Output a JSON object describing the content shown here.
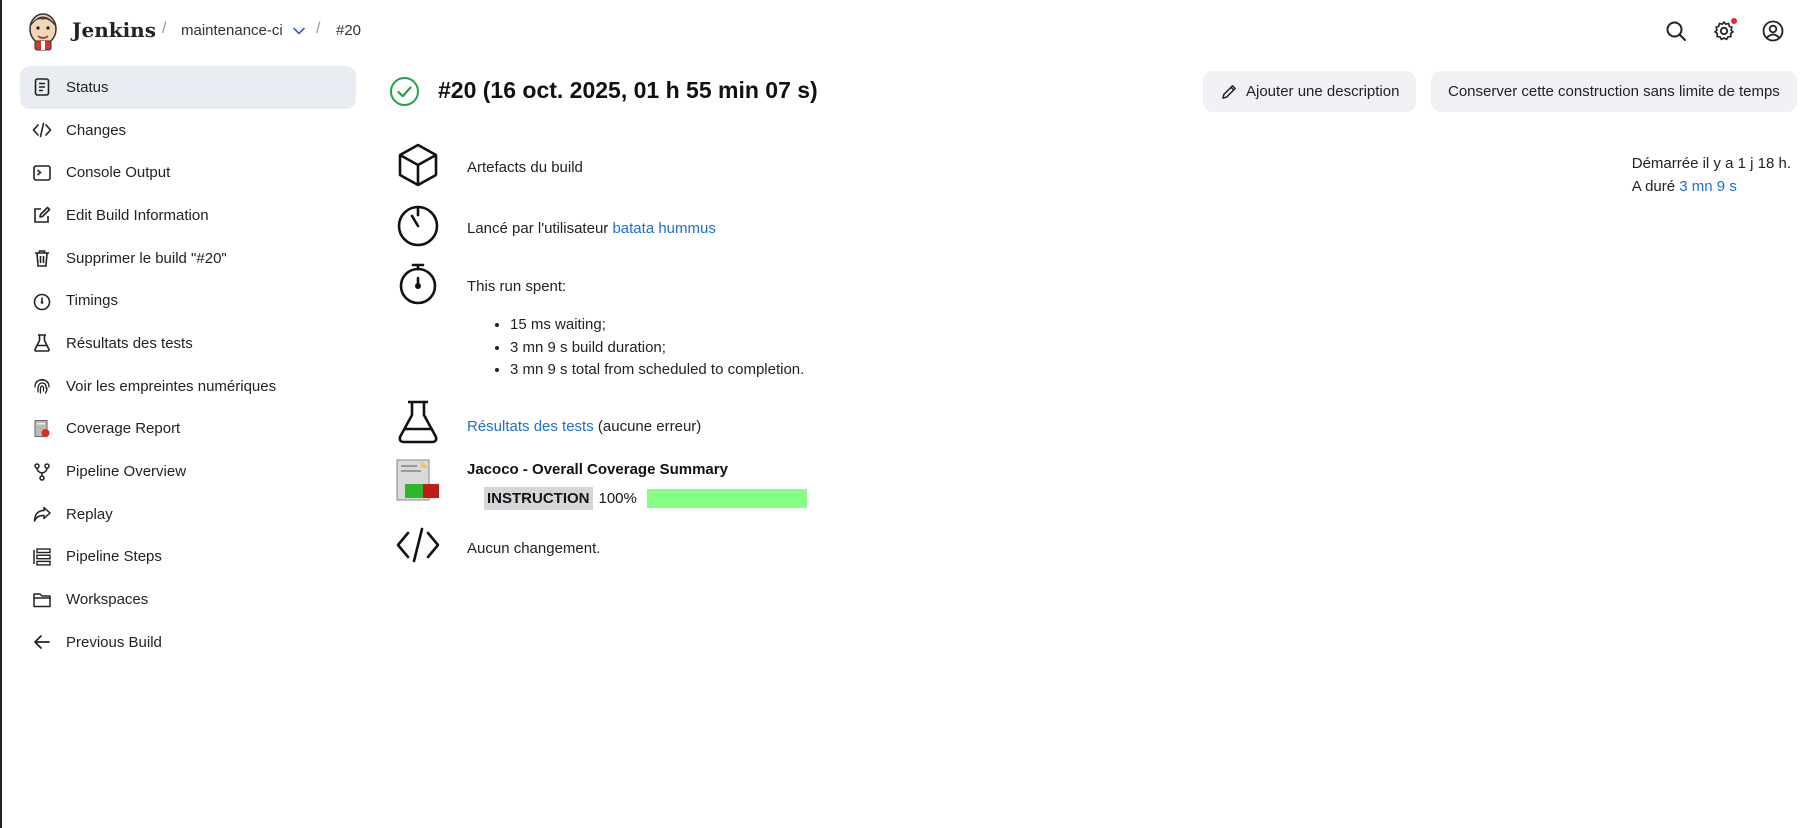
{
  "header": {
    "brand": "Jenkins",
    "breadcrumbs": [
      "maintenance-ci",
      "#20"
    ],
    "separator": "/",
    "icons": [
      "search-icon",
      "gear-icon",
      "user-account-icon"
    ]
  },
  "sidebar": {
    "items": [
      {
        "label": "Status",
        "icon": "status-document-icon",
        "active": true
      },
      {
        "label": "Changes",
        "icon": "code-icon"
      },
      {
        "label": "Console Output",
        "icon": "terminal-icon"
      },
      {
        "label": "Edit Build Information",
        "icon": "edit-icon"
      },
      {
        "label": "Supprimer le build \"#20\"",
        "icon": "trash-icon"
      },
      {
        "label": "Timings",
        "icon": "stopwatch-icon"
      },
      {
        "label": "Résultats des tests",
        "icon": "flask-icon"
      },
      {
        "label": "Voir les empreintes numériques",
        "icon": "fingerprint-icon"
      },
      {
        "label": "Coverage Report",
        "icon": "coverage-report-icon"
      },
      {
        "label": "Pipeline Overview",
        "icon": "pipeline-branch-icon"
      },
      {
        "label": "Replay",
        "icon": "replay-arrow-icon"
      },
      {
        "label": "Pipeline Steps",
        "icon": "list-steps-icon"
      },
      {
        "label": "Workspaces",
        "icon": "folder-icon"
      },
      {
        "label": "Previous Build",
        "icon": "arrow-left-icon"
      }
    ]
  },
  "main": {
    "title": "#20 (16 oct. 2025, 01 h 55 min 07 s)",
    "add_description": "Ajouter une description",
    "keep_forever": "Conserver cette construction sans limite de temps",
    "started": "Démarrée il y a 1 j 18 h.",
    "duration_prefix": "A duré",
    "duration_link": "3 mn 9 s",
    "artifacts_link": "Artefacts du build",
    "launched_prefix": "Lancé par l'utilisateur",
    "launched_user": "batata hummus",
    "spent_title": "This run spent:",
    "spent_items": [
      "15 ms waiting;",
      "3 mn 9 s build duration;",
      "3 mn 9 s total from scheduled to completion."
    ],
    "tests_link": "Résultats des tests",
    "tests_suffix": " (aucune erreur)",
    "jacoco_title": "Jacoco - Overall Coverage Summary",
    "coverage_label": "INSTRUCTION",
    "coverage_pct": "100%",
    "coverage_value": 1.0,
    "changes": "Aucun changement."
  },
  "colors": {
    "link": "#1b6fd8",
    "success": "#1ea446",
    "coverage_fill": "#85ff86",
    "active_bg": "#e9ecf3"
  }
}
